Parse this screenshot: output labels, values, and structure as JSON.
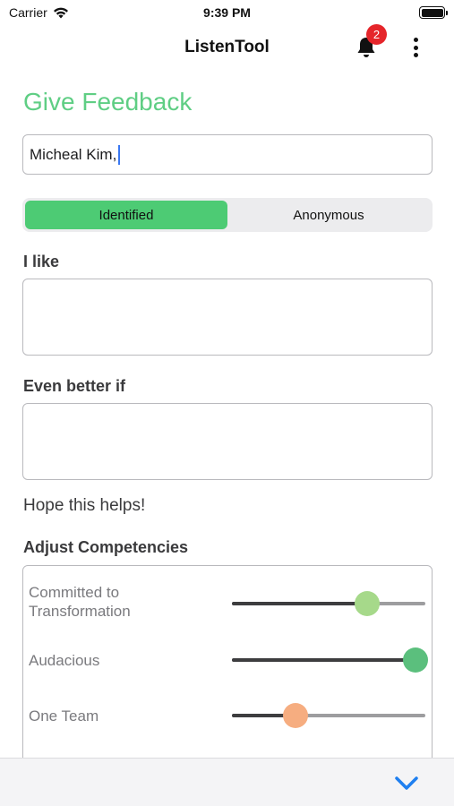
{
  "status_bar": {
    "carrier": "Carrier",
    "time": "9:39 PM"
  },
  "nav": {
    "title": "ListenTool",
    "notification_count": "2"
  },
  "form": {
    "heading": "Give Feedback",
    "name_value": "Micheal Kim,",
    "segments": [
      {
        "label": "Identified",
        "selected": true
      },
      {
        "label": "Anonymous",
        "selected": false
      }
    ],
    "i_like_label": "I like",
    "even_better_label": "Even better if",
    "closing_text": "Hope this helps!",
    "competencies_label": "Adjust Competencies",
    "competencies": [
      {
        "name": "Committed to Transformation",
        "value": 0.7,
        "color": "#a6d98a"
      },
      {
        "name": "Audacious",
        "value": 0.95,
        "color": "#5bbf7d"
      },
      {
        "name": "One Team",
        "value": 0.33,
        "color": "#f6ad80"
      }
    ]
  },
  "colors": {
    "accent": "#5fce84",
    "segment_active": "#4dcb74",
    "badge": "#e5252a",
    "chevron": "#1e7ff0"
  },
  "icons": [
    "wifi-icon",
    "battery-icon",
    "bell-icon",
    "more-vertical-icon",
    "chevron-down-icon"
  ]
}
